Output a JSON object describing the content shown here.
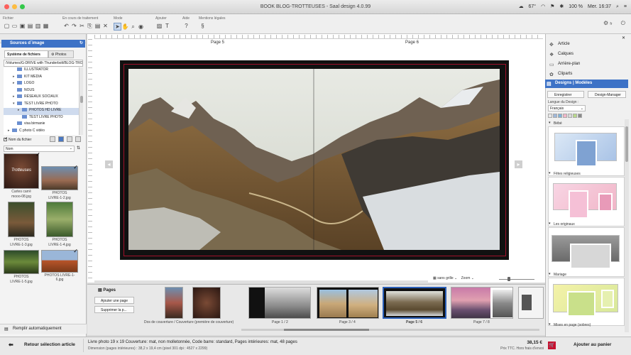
{
  "window": {
    "title": "BOOK BLOG-TROTTEUSES - Saal design 4.0.99"
  },
  "system": {
    "battery_temp": "67°",
    "battery": "100 %",
    "datetime": "Mer. 16:37"
  },
  "toolbar": {
    "groups": [
      "Fichier",
      "En cours de traitement",
      "Mode",
      "Ajouter",
      "Aide",
      "Mentions légales"
    ],
    "lang": "fr"
  },
  "left": {
    "title": "Sources d´image",
    "tabs": [
      "Système de fichiers",
      "Photos"
    ],
    "path": "/Volumes/G-DRIVE with Thunderbolt/BLOG-TROTTEUSES",
    "tree": [
      {
        "label": "ILLUSTRATOR",
        "level": 1,
        "arrow": ""
      },
      {
        "label": "KIT MEDIA",
        "level": 1,
        "arrow": "▸"
      },
      {
        "label": "LOGO",
        "level": 1,
        "arrow": "▸"
      },
      {
        "label": "NOUS",
        "level": 1,
        "arrow": ""
      },
      {
        "label": "RÉSEAUX SOCIAUX",
        "level": 1,
        "arrow": "▸"
      },
      {
        "label": "TEST LIVRE PHOTO",
        "level": 1,
        "arrow": "▾"
      },
      {
        "label": "PHOTOS HD LIVRE",
        "level": 2,
        "arrow": "▸",
        "selected": true
      },
      {
        "label": "TEST LIVRE PHOTO",
        "level": 2,
        "arrow": ""
      },
      {
        "label": "visa birmanie",
        "level": 1,
        "arrow": ""
      },
      {
        "label": "C photo C vidéo",
        "level": 0,
        "arrow": "▸"
      }
    ],
    "filename_label": "Nom du fichier",
    "sort_value": "Nom",
    "thumbs": [
      {
        "caption1": "Cartes carré",
        "caption2": "mooo-08.jpg",
        "checked": true
      },
      {
        "caption1": "PHOTOS",
        "caption2": "LIVRE-1-2.jpg",
        "checked": true
      },
      {
        "caption1": "PHOTOS",
        "caption2": "LIVRE-1-3.jpg",
        "checked": false
      },
      {
        "caption1": "PHOTOS",
        "caption2": "LIVRE-1-4.jpg",
        "checked": false
      },
      {
        "caption1": "PHOTOS",
        "caption2": "LIVRE-1-5.jpg",
        "checked": false
      },
      {
        "caption1": "PHOTOS LIVRE-1-6.jpg",
        "caption2": "",
        "checked": true
      }
    ],
    "autofill": "Remplir automatiquement"
  },
  "canvas": {
    "page_left": "Page 5",
    "page_right": "Page 6",
    "grid": "sans grille",
    "zoom": "Zoom"
  },
  "pages": {
    "title": "Pages",
    "add": "Ajouter une page",
    "delete": "Supprimer la p...",
    "labels": [
      "Dos de couverture / Couverture (première de couverture)",
      "Page 1 / 2",
      "Page 3 / 4",
      "Page 5 / 6",
      "Page 7 / 8"
    ]
  },
  "right": {
    "items": [
      "Article",
      "Calques",
      "Arrière-plan",
      "Cliparts",
      "Designs | Modèles"
    ],
    "save": "Enregistrer",
    "manager": "Design-Manager",
    "lang_label": "Langue du Design :",
    "lang_value": "Français",
    "categories": [
      "Bébé",
      "Fêtes religieuses",
      "Les originaux",
      "Mariage",
      "Mises en page (sobres)"
    ],
    "swatch_colors": [
      "#e8e8e8",
      "#9fb7d9",
      "#7fb3d9",
      "#f1b6c8",
      "#d9d9d9",
      "#b8d98a",
      "#8a8a8a"
    ]
  },
  "status": {
    "back": "Retour sélection article",
    "desc1": "Livre photo 19 x 19 Couverture: mat, non molletonnée, Code barre: standard, Pages intérieures: mat, 48 pages",
    "desc2": "Dimension (pages intérieures) : 38,2 x 19,4 cm (pixel 301 dpi : 4527 x 2299)",
    "price": "38,15 €",
    "price_note": "Prix TTC. Hors frais d'envoi",
    "cart": "Ajouter au panier"
  }
}
